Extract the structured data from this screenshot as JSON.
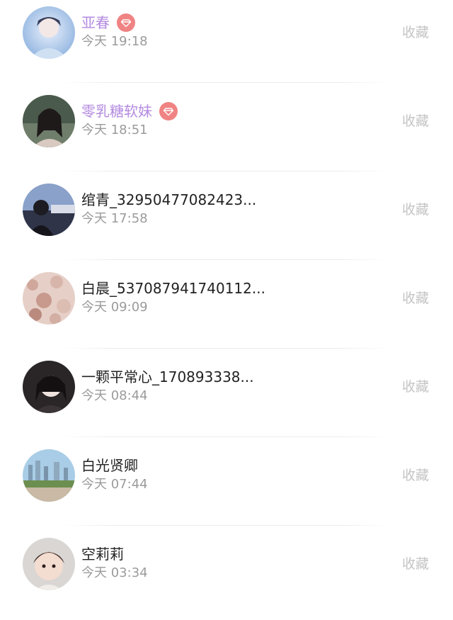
{
  "favorite_label": "收藏",
  "vip_color": "#b38ae0",
  "badge_color": "#f08383",
  "items": [
    {
      "name": "亚春",
      "time": "今天 19:18",
      "vip": true
    },
    {
      "name": "零乳糖软妹",
      "time": "今天 18:51",
      "vip": true
    },
    {
      "name": "绾青_32950477082423...",
      "time": "今天 17:58",
      "vip": false
    },
    {
      "name": "白晨_537087941740112...",
      "time": "今天 09:09",
      "vip": false
    },
    {
      "name": "一颗平常心_170893338...",
      "time": "今天 08:44",
      "vip": false
    },
    {
      "name": "白光贤卿",
      "time": "今天 07:44",
      "vip": false
    },
    {
      "name": "空莉莉",
      "time": "今天 03:34",
      "vip": false
    }
  ]
}
